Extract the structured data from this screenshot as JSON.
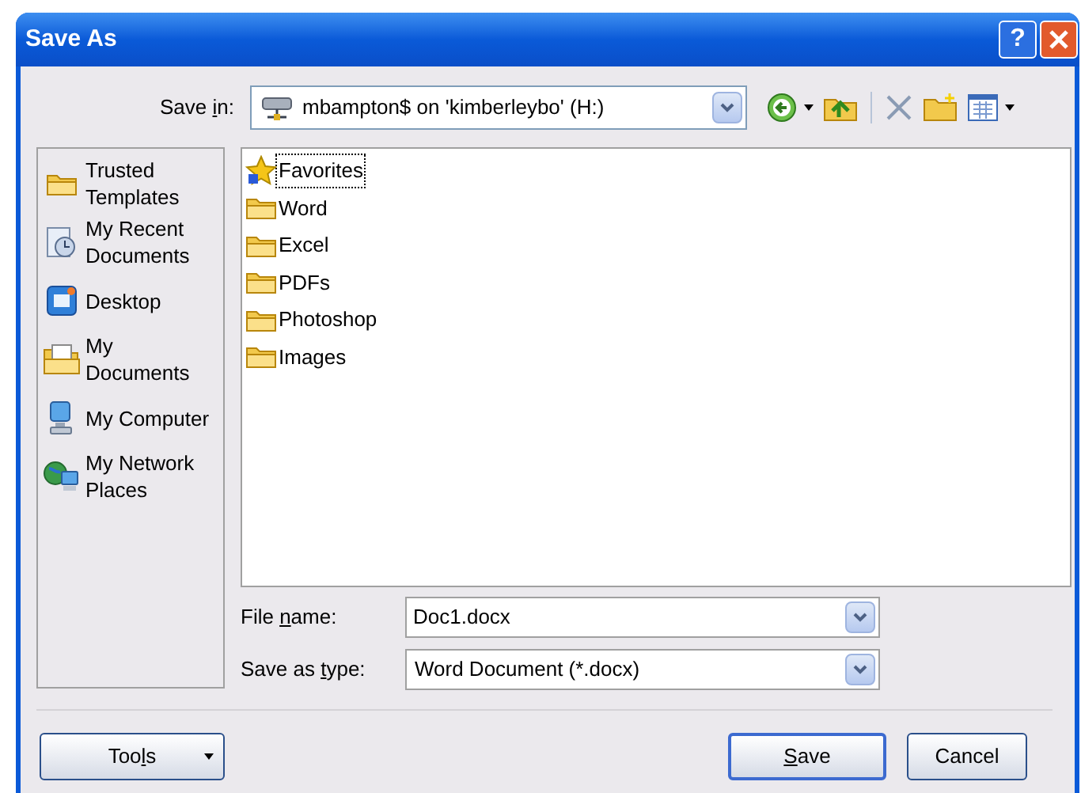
{
  "window": {
    "title": "Save As",
    "buttons": [
      {
        "kind": "help",
        "label": "?"
      },
      {
        "kind": "close"
      }
    ]
  },
  "save_in": {
    "label": {
      "pre": "Save ",
      "key": "i",
      "post": "n:"
    },
    "value": "mbampton$ on 'kimberleybo' (H:)"
  },
  "toolbar": [
    {
      "kind": "back",
      "caret": true
    },
    {
      "kind": "up",
      "caret": false
    },
    {
      "kind": "separator",
      "caret": false
    },
    {
      "kind": "delete",
      "caret": false
    },
    {
      "kind": "new-folder",
      "caret": false
    },
    {
      "kind": "views",
      "caret": true
    }
  ],
  "places": [
    {
      "kind": "folder",
      "label": "Trusted Templates"
    },
    {
      "kind": "recent",
      "label": "My Recent Documents"
    },
    {
      "kind": "desktop",
      "label": "Desktop"
    },
    {
      "kind": "documents",
      "label": "My Documents"
    },
    {
      "kind": "computer",
      "label": "My Computer"
    },
    {
      "kind": "network",
      "label": "My Network Places"
    }
  ],
  "files": [
    {
      "kind": "favorites",
      "name": "Favorites",
      "selected": true
    },
    {
      "kind": "folder",
      "name": "Word",
      "selected": false
    },
    {
      "kind": "folder",
      "name": "Excel",
      "selected": false
    },
    {
      "kind": "folder",
      "name": "PDFs",
      "selected": false
    },
    {
      "kind": "folder",
      "name": "Photoshop",
      "selected": false
    },
    {
      "kind": "folder",
      "name": "Images",
      "selected": false
    }
  ],
  "file_name": {
    "label": {
      "pre": "File ",
      "key": "n",
      "post": "ame:"
    },
    "value": "Doc1.docx"
  },
  "save_as_type": {
    "label": {
      "pre": "Save as ",
      "key": "t",
      "post": "ype:"
    },
    "value": "Word Document (*.docx)"
  },
  "buttons": [
    {
      "kind": "menu",
      "label": {
        "pre": "Too",
        "key": "l",
        "post": "s"
      },
      "default": false
    },
    {
      "kind": "push",
      "label": {
        "key": "S",
        "post": "ave"
      },
      "default": true
    },
    {
      "kind": "push",
      "label": {
        "pre": "Cancel"
      },
      "default": false
    }
  ]
}
